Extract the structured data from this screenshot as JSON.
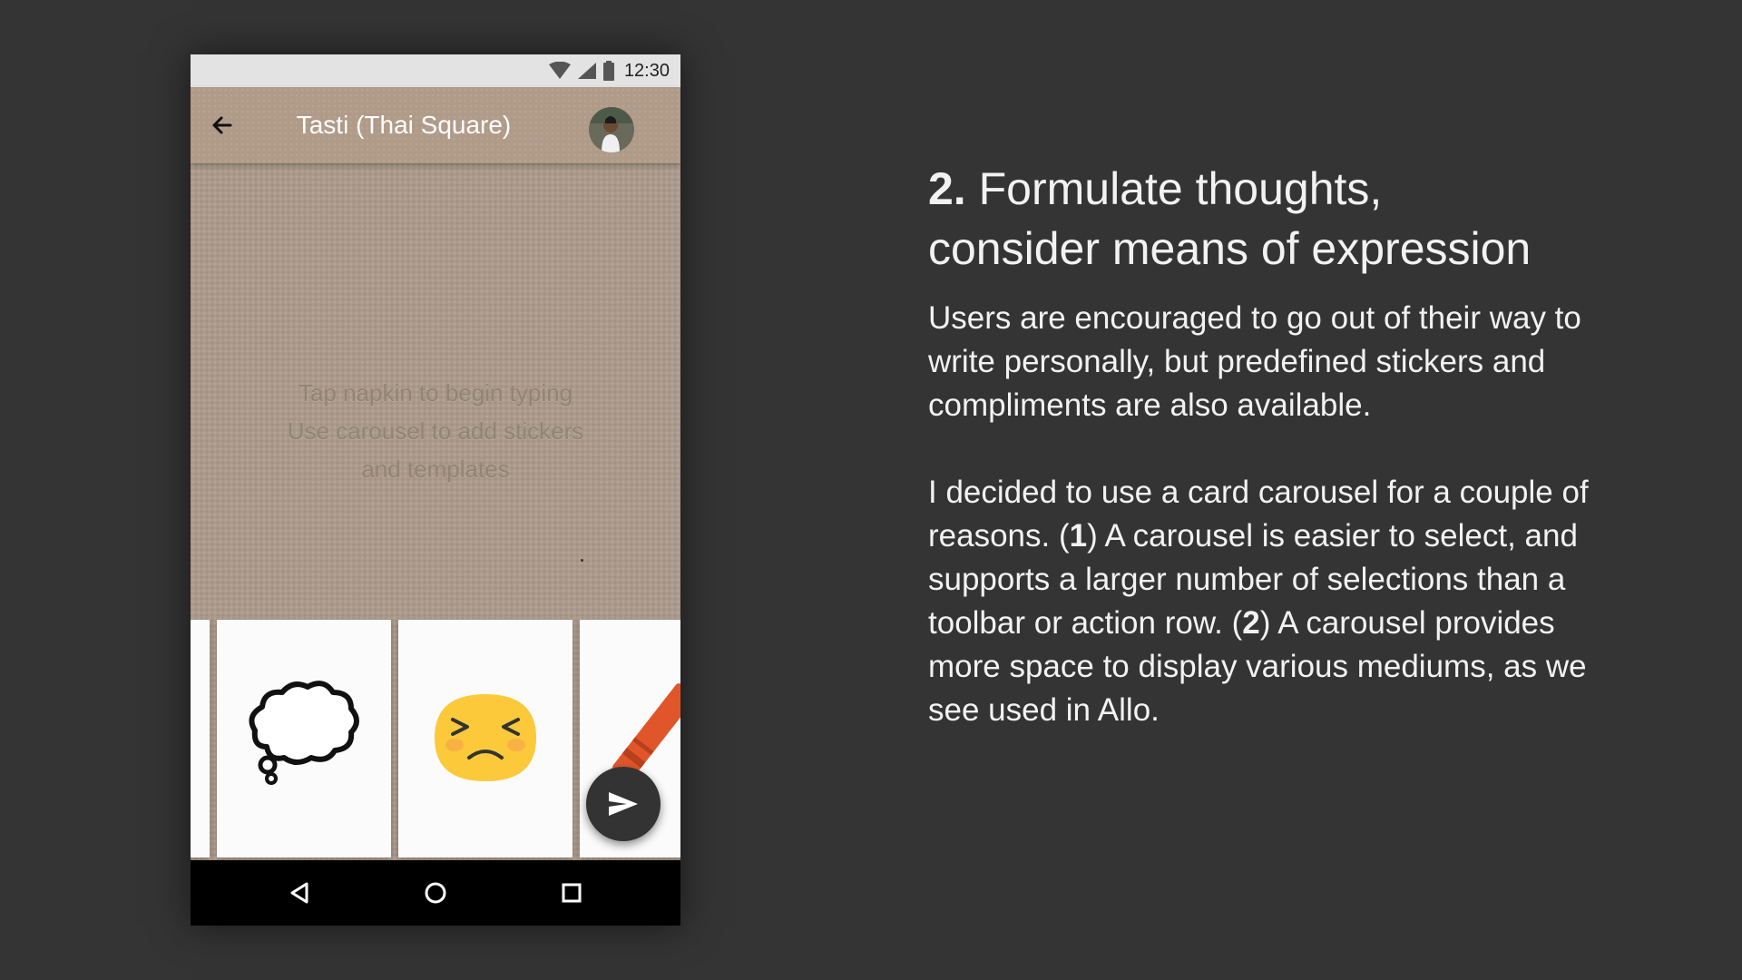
{
  "phone": {
    "status_bar": {
      "time": "12:30"
    },
    "app_bar": {
      "title": "Tasti (Thai Square)"
    },
    "napkin": {
      "hint_lines": [
        "Tap napkin to begin typing",
        "Use carousel to add stickers",
        "and templates"
      ]
    },
    "carousel": {
      "cards": [
        {
          "icon": "blank-card"
        },
        {
          "icon": "thought-bubble-icon"
        },
        {
          "icon": "frustrated-face-icon"
        },
        {
          "icon": "crayon-icon"
        }
      ]
    },
    "fab": {
      "icon": "send-icon"
    },
    "nav_bar": {
      "icons": [
        "back-triangle-icon",
        "home-circle-icon",
        "recents-square-icon"
      ]
    }
  },
  "panel": {
    "heading": {
      "number": "2.",
      "line1": "Formulate thoughts,",
      "line2": "consider means of expression"
    },
    "paragraph1": "Users are encouraged to go out of their way to write personally, but predefined stickers and compliments are also available.",
    "paragraph2": {
      "intro": "I decided to use a card carousel for a couple of reasons. (",
      "num1": "1",
      "part1": ") A carousel is easier to select, and supports a larger number of selections than a toolbar or action row. (",
      "num2": "2",
      "part2": ") A carousel provides more space to display various mediums, as we see used in Allo."
    }
  },
  "colors": {
    "background": "#343434",
    "napkin": "#ab9a8b",
    "app_bar": "#b09a88",
    "fab": "#333333",
    "text": "#f2f2f2"
  }
}
